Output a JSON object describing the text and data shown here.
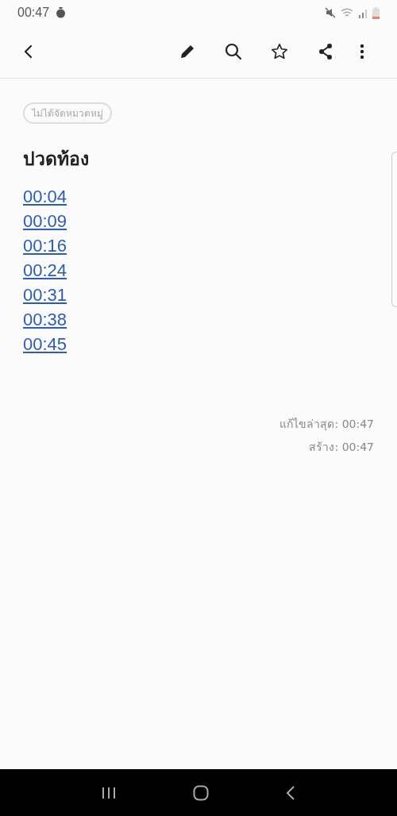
{
  "status_bar": {
    "time": "00:47"
  },
  "note": {
    "category": "ไม่ได้จัดหมวดหมู่",
    "title": "ปวดท้อง",
    "links": [
      "00:04",
      "00:09",
      "00:16",
      "00:24",
      "00:31",
      "00:38",
      "00:45"
    ],
    "modified": "แก้ไขล่าสุด: 00:47",
    "created": "สร้าง: 00:47"
  }
}
